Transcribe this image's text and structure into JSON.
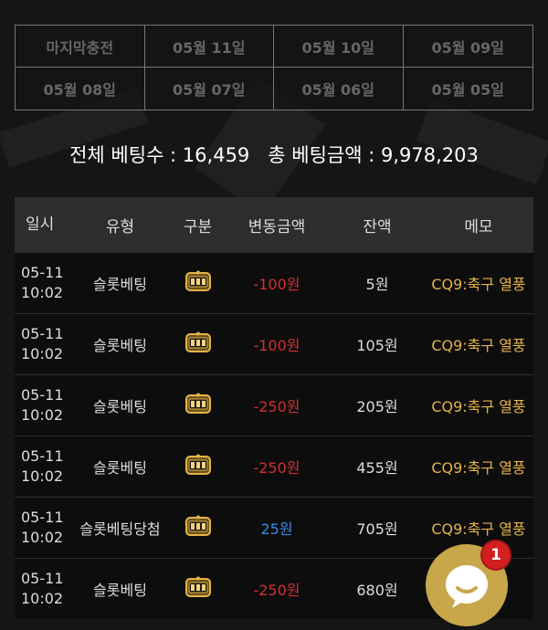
{
  "date_tabs": [
    "마지막충전",
    "05월 11일",
    "05월 10일",
    "05월 09일",
    "05월 08일",
    "05월 07일",
    "05월 06일",
    "05월 05일"
  ],
  "stats": {
    "total_bets_label": "전체 베팅수 : 16,459",
    "total_amount_label": "총 베팅금액 : 9,978,203"
  },
  "table": {
    "headers": {
      "date": "일시",
      "type": "유형",
      "kind": "구분",
      "change": "변동금액",
      "balance": "잔액",
      "memo": "메모"
    },
    "rows": [
      {
        "date": "05-11",
        "time": "10:02",
        "type": "슬롯베팅",
        "kind_icon": "slot-machine-icon",
        "change": "-100원",
        "change_sign": "neg",
        "balance": "5원",
        "memo": "CQ9:축구 열풍"
      },
      {
        "date": "05-11",
        "time": "10:02",
        "type": "슬롯베팅",
        "kind_icon": "slot-machine-icon",
        "change": "-100원",
        "change_sign": "neg",
        "balance": "105원",
        "memo": "CQ9:축구 열풍"
      },
      {
        "date": "05-11",
        "time": "10:02",
        "type": "슬롯베팅",
        "kind_icon": "slot-machine-icon",
        "change": "-250원",
        "change_sign": "neg",
        "balance": "205원",
        "memo": "CQ9:축구 열풍"
      },
      {
        "date": "05-11",
        "time": "10:02",
        "type": "슬롯베팅",
        "kind_icon": "slot-machine-icon",
        "change": "-250원",
        "change_sign": "neg",
        "balance": "455원",
        "memo": "CQ9:축구 열풍"
      },
      {
        "date": "05-11",
        "time": "10:02",
        "type": "슬롯베팅당첨",
        "kind_icon": "slot-machine-icon",
        "change": "25원",
        "change_sign": "pos",
        "balance": "705원",
        "memo": "CQ9:축구 열풍"
      },
      {
        "date": "05-11",
        "time": "10:02",
        "type": "슬롯베팅",
        "kind_icon": "slot-machine-icon",
        "change": "-250원",
        "change_sign": "neg",
        "balance": "680원",
        "memo": "열풍"
      }
    ]
  },
  "chat": {
    "badge_count": "1",
    "icon": "chat-bubble-icon"
  },
  "colors": {
    "negative": "#d23030",
    "positive": "#3a8ee6",
    "memo": "#e6b34a",
    "chat_button": "#c8a64a",
    "badge": "#d21f1f"
  }
}
